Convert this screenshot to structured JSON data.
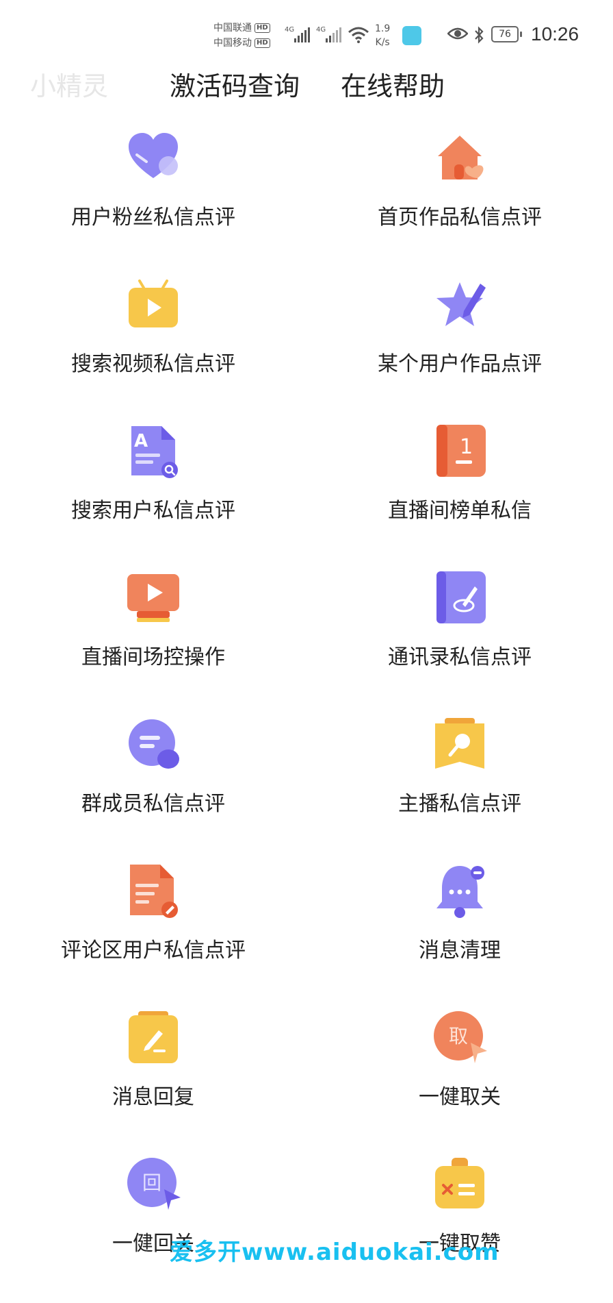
{
  "status_bar": {
    "carrier1": "中国联通",
    "carrier2": "中国移动",
    "hd": "HD",
    "net_label": "4G",
    "net_speed_value": "1.9",
    "net_speed_unit": "K/s",
    "battery": "76",
    "time": "10:26"
  },
  "header": {
    "brand": "小精灵",
    "nav": [
      "激活码查询",
      "在线帮助"
    ]
  },
  "grid": {
    "items": [
      {
        "label": "用户粉丝私信点评",
        "icon": "heart-icon"
      },
      {
        "label": "首页作品私信点评",
        "icon": "home-icon"
      },
      {
        "label": "搜索视频私信点评",
        "icon": "tv-play-icon"
      },
      {
        "label": "某个用户作品点评",
        "icon": "star-pen-icon"
      },
      {
        "label": "搜索用户私信点评",
        "icon": "document-search-icon"
      },
      {
        "label": "直播间榜单私信",
        "icon": "ranking-book-icon"
      },
      {
        "label": "直播间场控操作",
        "icon": "live-screen-icon"
      },
      {
        "label": "通讯录私信点评",
        "icon": "contact-book-icon"
      },
      {
        "label": "群成员私信点评",
        "icon": "chat-bubble-icon"
      },
      {
        "label": "主播私信点评",
        "icon": "microphone-badge-icon"
      },
      {
        "label": "评论区用户私信点评",
        "icon": "edit-document-icon"
      },
      {
        "label": "消息清理",
        "icon": "bell-icon"
      },
      {
        "label": "消息回复",
        "icon": "clipboard-pen-icon"
      },
      {
        "label": "一健取关",
        "icon": "unfollow-circle-icon",
        "glyph": "取"
      },
      {
        "label": "一健回关",
        "icon": "follow-back-circle-icon",
        "glyph": "回"
      },
      {
        "label": "一键取赞",
        "icon": "remove-like-icon"
      }
    ]
  },
  "watermark": "爱多开www.aiduokai.com",
  "colors": {
    "purple": "#8f86f4",
    "purple_dark": "#6c5ce7",
    "orange": "#f0845c",
    "orange_dark": "#e65c34",
    "yellow": "#f7c74a",
    "text": "#222222",
    "brand_gray": "#e6e6e6",
    "watermark": "#19c0f0"
  }
}
